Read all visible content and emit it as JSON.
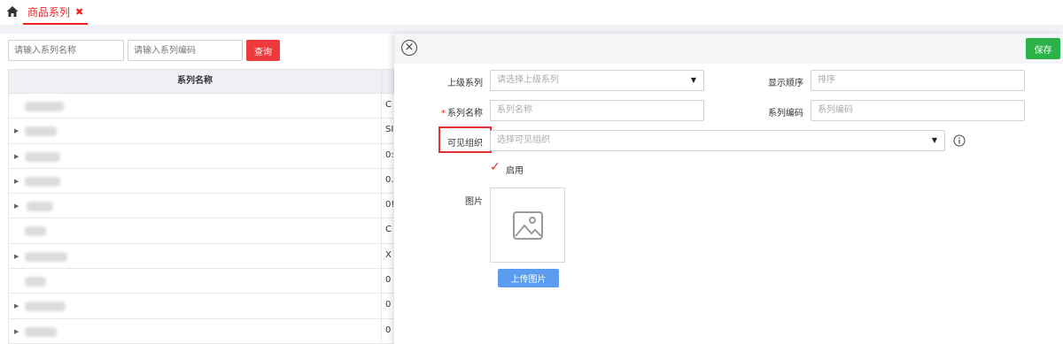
{
  "tabbar": {
    "home_icon": "home-icon",
    "active_tab": {
      "label": "商品系列",
      "close_icon": "close-icon"
    }
  },
  "list": {
    "search_name_placeholder": "请输入系列名称",
    "search_code_placeholder": "请输入系列编码",
    "query_label": "查询",
    "column_name": "系列名称",
    "rows": [
      {
        "expandable": false,
        "code": "C"
      },
      {
        "expandable": true,
        "code": "SI"
      },
      {
        "expandable": true,
        "code": "0:"
      },
      {
        "expandable": true,
        "code": "0."
      },
      {
        "expandable": true,
        "code": "0!"
      },
      {
        "expandable": false,
        "code": "C"
      },
      {
        "expandable": true,
        "code": "X"
      },
      {
        "expandable": false,
        "code": "0"
      },
      {
        "expandable": true,
        "code": "0"
      },
      {
        "expandable": true,
        "code": "0"
      }
    ]
  },
  "form": {
    "close_icon": "close-circle-icon",
    "save_label": "保存",
    "parent_series": {
      "label": "上级系列",
      "placeholder": "请选择上级系列"
    },
    "display_order": {
      "label": "显示顺序",
      "placeholder": "排序"
    },
    "series_name": {
      "required_mark": "*",
      "label": "系列名称",
      "placeholder": "系列名称"
    },
    "series_code": {
      "label": "系列编码",
      "placeholder": "系列编码"
    },
    "visible_org": {
      "label": "可见组织",
      "placeholder": "选择可见组织"
    },
    "enabled": {
      "label": "启用",
      "checked": true
    },
    "image": {
      "label": "图片",
      "icon": "image-placeholder-icon"
    },
    "upload_label": "上传图片",
    "colors": {
      "primary_red": "#ee3a3a",
      "save_green": "#2bb34a",
      "upload_blue": "#5b9bf0"
    }
  }
}
